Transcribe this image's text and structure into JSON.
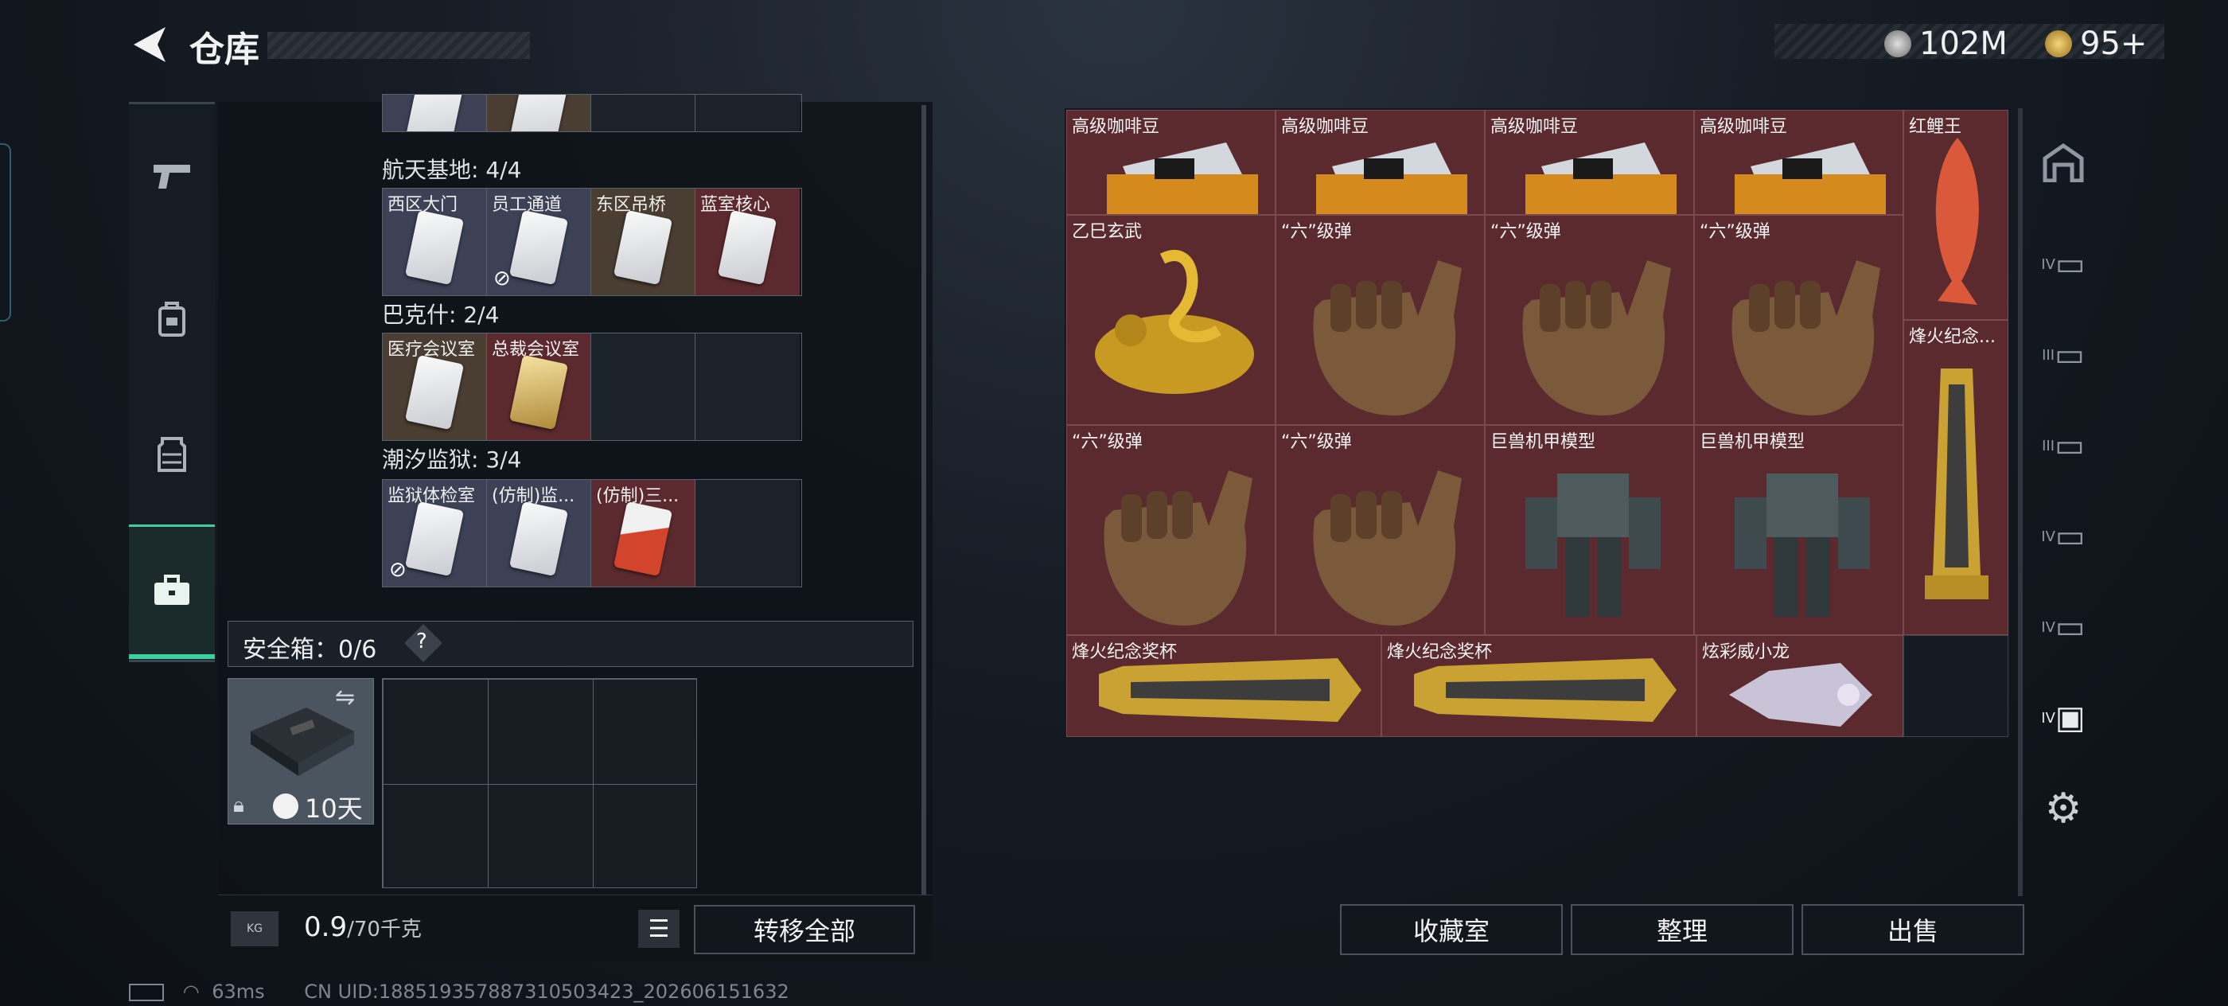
{
  "header": {
    "title": "仓库",
    "currency1": "102M",
    "currency2": "95+"
  },
  "nav": {
    "items": [
      "gun-icon",
      "backpack-icon",
      "vest-icon",
      "toolbox-icon"
    ]
  },
  "keys": {
    "top_row": [
      "",
      "",
      "",
      ""
    ],
    "groups": [
      {
        "title": "航天基地: 4/4",
        "slots": [
          {
            "name": "西区大门",
            "color": "blue"
          },
          {
            "name": "员工通道",
            "color": "blue",
            "badge": "⃠"
          },
          {
            "name": "东区吊桥",
            "color": "brown"
          },
          {
            "name": "蓝室核心",
            "color": "red"
          }
        ]
      },
      {
        "title": "巴克什: 2/4",
        "slots": [
          {
            "name": "医疗会议室",
            "color": "brown"
          },
          {
            "name": "总裁会议室",
            "color": "red",
            "card": "gold"
          },
          {
            "name": "",
            "color": "empty"
          },
          {
            "name": "",
            "color": "empty"
          }
        ]
      },
      {
        "title": "潮汐监狱: 3/4",
        "slots": [
          {
            "name": "监狱体检室",
            "color": "blue",
            "badge": "⃠"
          },
          {
            "name": "(仿制)监...",
            "color": "blue"
          },
          {
            "name": "(仿制)三...",
            "color": "red",
            "card": "red"
          },
          {
            "name": "",
            "color": "empty"
          }
        ]
      }
    ]
  },
  "safe": {
    "label": "安全箱：0/6",
    "help": "?",
    "timer": "10天"
  },
  "weight": {
    "value": "0.9",
    "unit": "/70千克",
    "kg_label": "KG"
  },
  "buttons": {
    "transfer_all": "转移全部",
    "collection": "收藏室",
    "sort": "整理",
    "sell": "出售"
  },
  "inventory": [
    {
      "name": "高级咖啡豆",
      "art": "coffee"
    },
    {
      "name": "高级咖啡豆",
      "art": "coffee"
    },
    {
      "name": "高级咖啡豆",
      "art": "coffee"
    },
    {
      "name": "高级咖啡豆",
      "art": "coffee"
    },
    {
      "name": "红鲤王",
      "art": "fish"
    },
    {
      "name": "乙巳玄武",
      "art": "dragon"
    },
    {
      "name": "“六”级弹",
      "art": "hand"
    },
    {
      "name": "“六”级弹",
      "art": "hand"
    },
    {
      "name": "“六”级弹",
      "art": "hand"
    },
    {
      "name": "烽火纪念...",
      "art": "trophy"
    },
    {
      "name": "“六”级弹",
      "art": "hand"
    },
    {
      "name": "“六”级弹",
      "art": "hand"
    },
    {
      "name": "巨兽机甲模型",
      "art": "mech"
    },
    {
      "name": "巨兽机甲模型",
      "art": "mech"
    },
    {
      "name": "烽火纪念奖杯",
      "art": "trophy-h"
    },
    {
      "name": "烽火纪念奖杯",
      "art": "trophy-h"
    },
    {
      "name": "炫彩威小龙",
      "art": "toy"
    }
  ],
  "footer": {
    "ping": "63ms",
    "uid": "CN UID:188519357887310503423_202606151632"
  }
}
